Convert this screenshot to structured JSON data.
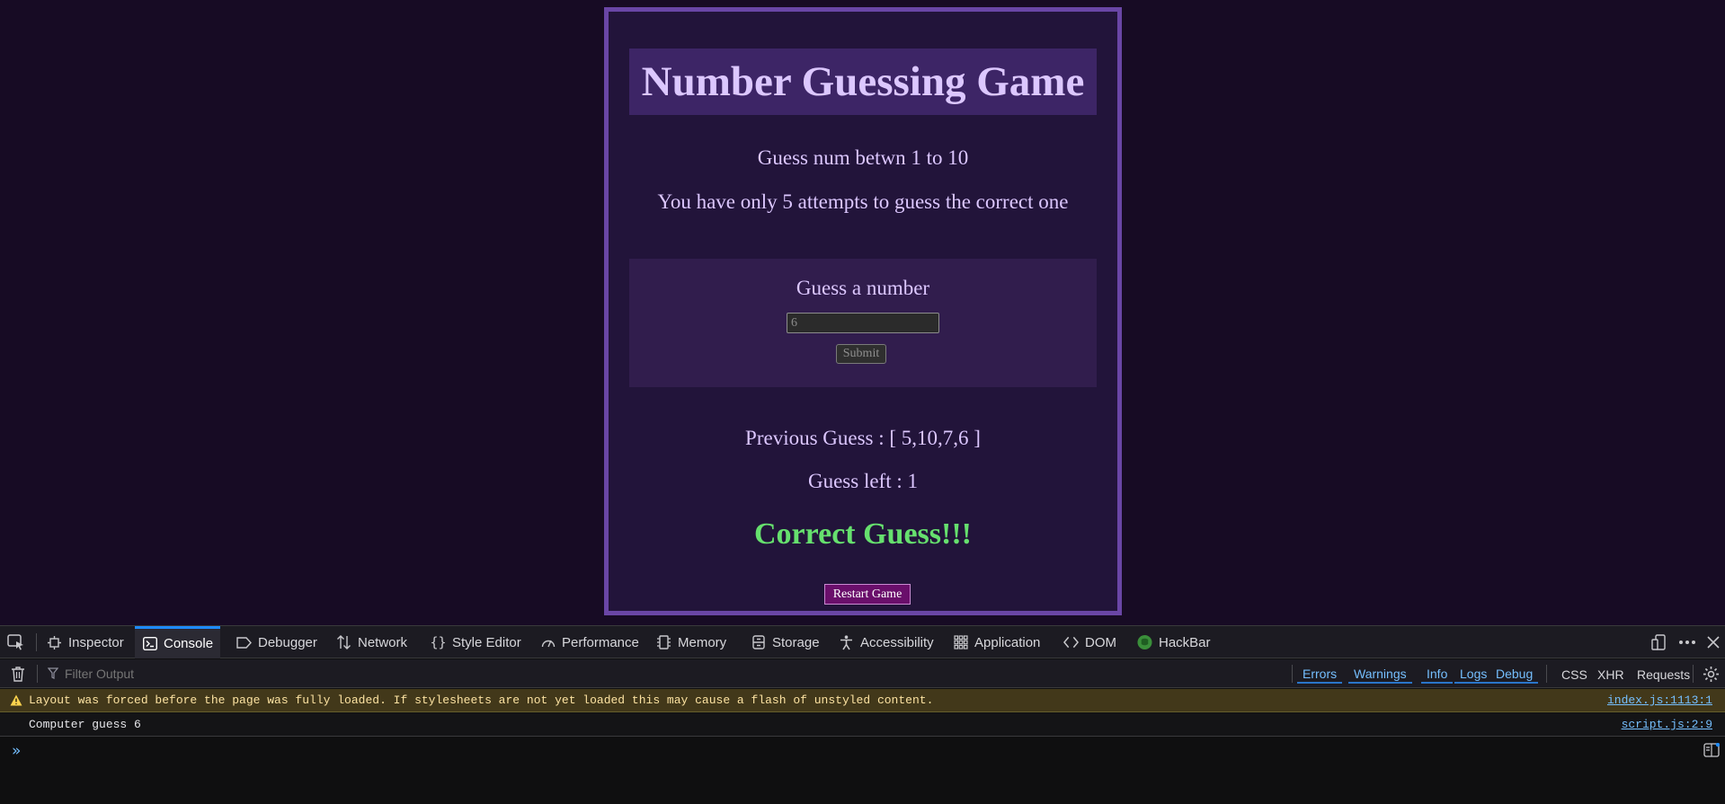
{
  "game": {
    "title": "Number Guessing Game",
    "intro_line1": "Guess num betwn 1 to 10",
    "intro_line2": "You have only 5 attempts to guess the correct one",
    "form_label": "Guess a number",
    "input_value": "6",
    "submit_label": "Submit",
    "previous_guess": "Previous Guess : [ 5,10,7,6 ]",
    "guess_left": "Guess left : 1",
    "result": "Correct Guess!!!",
    "restart_label": "Restart Game"
  },
  "devtools": {
    "tabs": [
      {
        "label": "Inspector",
        "icon": "inspector-icon"
      },
      {
        "label": "Console",
        "icon": "console-icon"
      },
      {
        "label": "Debugger",
        "icon": "debugger-icon"
      },
      {
        "label": "Network",
        "icon": "network-icon"
      },
      {
        "label": "Style Editor",
        "icon": "style-editor-icon"
      },
      {
        "label": "Performance",
        "icon": "performance-icon"
      },
      {
        "label": "Memory",
        "icon": "memory-icon"
      },
      {
        "label": "Storage",
        "icon": "storage-icon"
      },
      {
        "label": "Accessibility",
        "icon": "accessibility-icon"
      },
      {
        "label": "Application",
        "icon": "application-icon"
      },
      {
        "label": "DOM",
        "icon": "dom-icon"
      },
      {
        "label": "HackBar",
        "icon": "hackbar-icon"
      }
    ],
    "active_tab": "Console",
    "filter_placeholder": "Filter Output",
    "filters": {
      "errors": "Errors",
      "warnings": "Warnings",
      "info": "Info",
      "logs": "Logs",
      "debug": "Debug"
    },
    "net_filters": {
      "css": "CSS",
      "xhr": "XHR",
      "requests": "Requests"
    },
    "messages": [
      {
        "type": "warning",
        "text": "Layout was forced before the page was fully loaded. If stylesheets are not yet loaded this may cause a flash of unstyled content.",
        "source": "index.js:1113:1"
      },
      {
        "type": "log",
        "text": "Computer guess 6",
        "source": "script.js:2:9"
      }
    ],
    "colors": {
      "accent": "#1e8bff",
      "link": "#75bfff",
      "warning_bg": "#42381a"
    }
  }
}
